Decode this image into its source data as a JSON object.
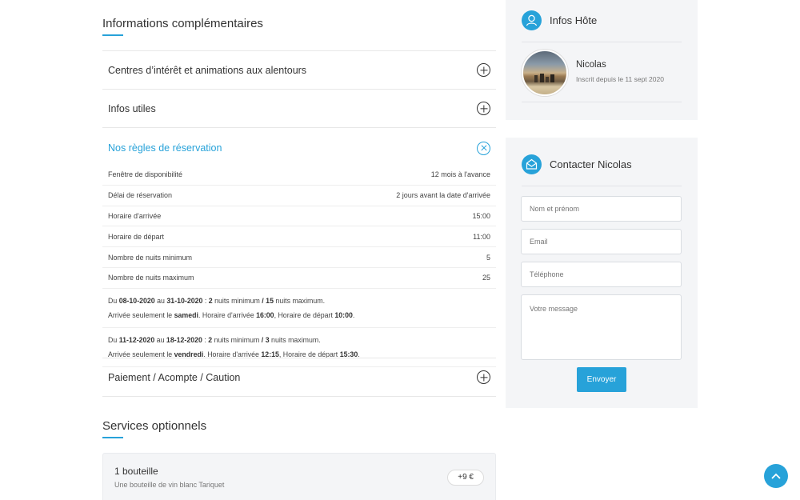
{
  "info": {
    "title": "Informations complémentaires",
    "accordion": [
      {
        "label": "Centres d’intérêt et animations aux alentours",
        "open": false
      },
      {
        "label": "Infos utiles",
        "open": false
      },
      {
        "label": "Nos règles de réservation",
        "open": true
      },
      {
        "label": "Paiement / Acompte / Caution",
        "open": false
      }
    ],
    "rules": [
      {
        "label": "Fenêtre de disponibilité",
        "value": "12 mois à l'avance"
      },
      {
        "label": "Délai de réservation",
        "value": "2 jours avant la date d'arrivée"
      },
      {
        "label": "Horaire d'arrivée",
        "value": "15:00"
      },
      {
        "label": "Horaire de départ",
        "value": "11:00"
      },
      {
        "label": "Nombre de nuits minimum",
        "value": "5"
      },
      {
        "label": "Nombre de nuits maximum",
        "value": "25"
      }
    ],
    "periods": [
      {
        "from": "08-10-2020",
        "to": "31-10-2020",
        "min": "2",
        "max": "15",
        "day": "samedi",
        "arrival": "16:00",
        "departure": "10:00"
      },
      {
        "from": "11-12-2020",
        "to": "18-12-2020",
        "min": "2",
        "max": "3",
        "day": "vendredi",
        "arrival": "12:15",
        "departure": "15:30"
      }
    ],
    "period_text": {
      "du": "Du",
      "au": "au",
      "nights_min": "nuits minimum",
      "slash": "/",
      "nights_max": "nuits maximum.",
      "arrival_only": "Arrivée seulement le",
      "arrival_time": "Horaire d'arrivée",
      "departure_time": "Horaire de départ"
    }
  },
  "services": {
    "title": "Services optionnels",
    "items": [
      {
        "name": "1 bouteille",
        "description": "Une bouteille de vin blanc Tariquet",
        "price": "+9 €"
      }
    ]
  },
  "host": {
    "title": "Infos Hôte",
    "name": "Nicolas",
    "since": "Inscrit depuis le 11 sept 2020"
  },
  "contact": {
    "title": "Contacter Nicolas",
    "name_placeholder": "Nom et prénom",
    "email_placeholder": "Email",
    "phone_placeholder": "Téléphone",
    "message_placeholder": "Votre message",
    "send_label": "Envoyer"
  },
  "colors": {
    "accent": "#27a2d9",
    "panel": "#f4f5f7"
  },
  "icons": {
    "host": "user-icon",
    "contact": "envelope-icon",
    "expand": "plus-circle-icon",
    "collapse": "close-circle-icon",
    "scroll_top": "chevron-up-icon"
  }
}
